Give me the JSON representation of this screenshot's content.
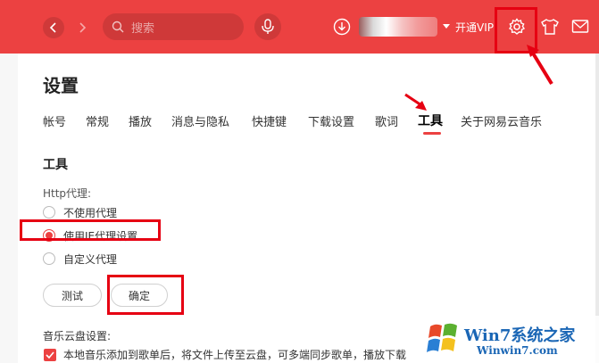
{
  "topbar": {
    "search_placeholder": "搜索",
    "vip_label": "开通VIP"
  },
  "settings": {
    "title": "设置",
    "tabs": [
      {
        "label": "帐号"
      },
      {
        "label": "常规"
      },
      {
        "label": "播放"
      },
      {
        "label": "消息与隐私"
      },
      {
        "label": "快捷键"
      },
      {
        "label": "下载设置"
      },
      {
        "label": "歌词"
      },
      {
        "label": "工具"
      },
      {
        "label": "关于网易云音乐"
      }
    ],
    "active_tab": "工具",
    "section_title": "工具",
    "proxy_label": "Http代理:",
    "proxy_options": [
      {
        "label": "不使用代理",
        "checked": false
      },
      {
        "label": "使用IE代理设置",
        "checked": true
      },
      {
        "label": "自定义代理",
        "checked": false
      }
    ],
    "test_button": "测试",
    "confirm_button": "确定",
    "cloud_label": "音乐云盘设置:",
    "cloud_option": "本地音乐添加到歌单后，将文件上传至云盘，可多端同步歌单，播放下载",
    "cloud_option_checked": true
  },
  "watermark": {
    "text": "Win7系统之家",
    "sub": "Winwin7.com"
  },
  "colors": {
    "accent": "#ec4141",
    "annotation": "#e60012"
  }
}
